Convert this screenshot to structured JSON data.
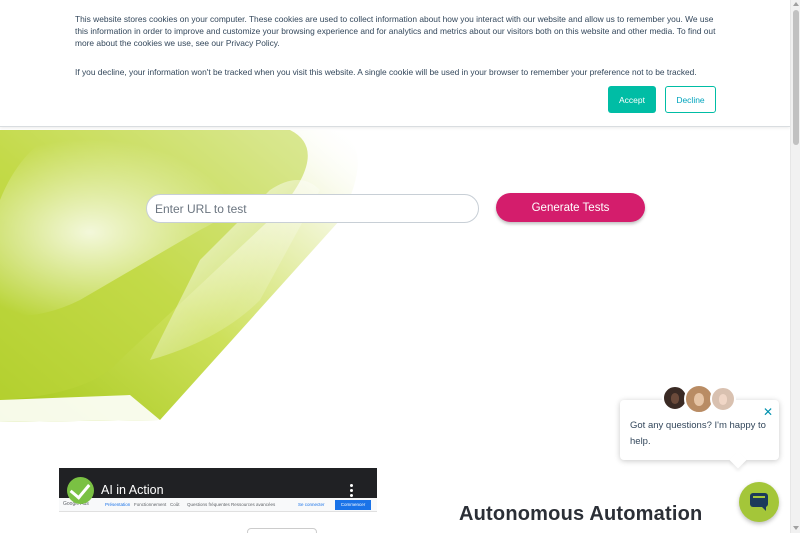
{
  "cookie_banner": {
    "paragraph_1": "This website stores cookies on your computer. These cookies are used to collect information about how you interact with our website and allow us to remember you. We use this information in order to improve and customize your browsing experience and for analytics and metrics about our visitors both on this website and other media. To find out more about the cookies we use, see our Privacy Policy.",
    "paragraph_2": "If you decline, your information won't be tracked when you visit this website. A single cookie will be used in your browser to remember your preference not to be tracked.",
    "accept_label": "Accept",
    "decline_label": "Decline"
  },
  "hero": {
    "url_placeholder": "Enter URL to test",
    "generate_label": "Generate Tests"
  },
  "video": {
    "title": "AI in Action",
    "inner_brand": "Google Ads",
    "inner_tabs": [
      "Présentation",
      "Fonctionnement",
      "Coût",
      "Questions fréquentes",
      "Ressources avancées"
    ],
    "inner_signin": "Se connecter",
    "inner_cta": "Commencer"
  },
  "section": {
    "heading": "Autonomous Automation"
  },
  "chat": {
    "message": "Got any questions? I'm happy to help.",
    "close_icon": "close-icon",
    "launcher_icon": "chat-bubble-icon"
  },
  "colors": {
    "accept": "#00bda5",
    "generate": "#d41d6c",
    "hero_green": "#b5d22e",
    "launcher": "#a4c639"
  }
}
